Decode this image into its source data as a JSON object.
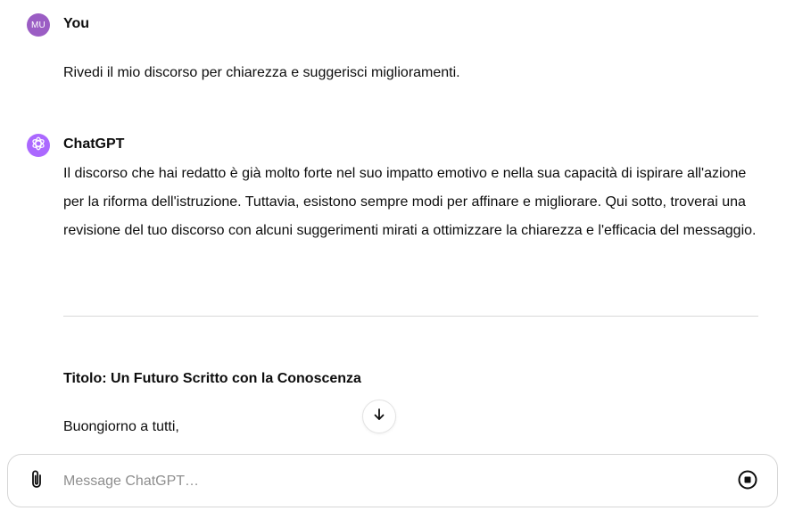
{
  "user": {
    "avatar_initials": "MU",
    "avatar_color": "#9b5dc4",
    "name": "You",
    "message": "Rivedi il mio discorso per chiarezza e suggerisci miglioramenti."
  },
  "assistant": {
    "name": "ChatGPT",
    "avatar_icon": "openai-logo-icon",
    "avatar_color": "#ab68ff",
    "paragraph": "Il discorso che hai redatto è già molto forte nel suo impatto emotivo e nella sua capacità di ispirare all'azione per la riforma dell'istruzione. Tuttavia, esistono sempre modi per affinare e migliorare. Qui sotto, troverai una revisione del tuo discorso con alcuni suggerimenti mirati a ottimizzare la chiarezza e l'efficacia del messaggio.",
    "heading": "Titolo: Un Futuro Scritto con la Conoscenza",
    "greeting": "Buongiorno a tutti,"
  },
  "scroll_down_icon": "arrow-down-icon",
  "composer": {
    "placeholder": "Message ChatGPT…",
    "value": "",
    "attach_icon": "paperclip-icon",
    "stop_icon": "stop-icon"
  }
}
